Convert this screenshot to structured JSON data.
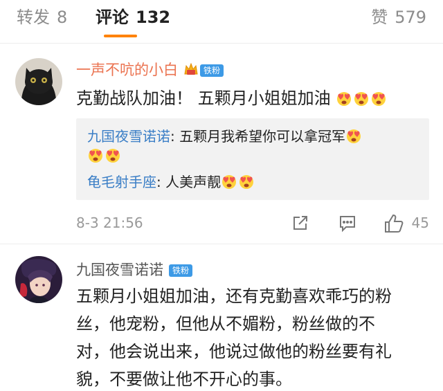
{
  "tabs": {
    "repost": {
      "label": "转发",
      "count": "8"
    },
    "comments": {
      "label": "评论",
      "count": "132"
    },
    "likes": {
      "label": "赞",
      "count": "579"
    }
  },
  "comments": [
    {
      "username": "一声不吭的小白",
      "fan_badge": "铁粉",
      "text": "克勤战队加油！ 五颗月小姐姐加油",
      "emojis": [
        "love-heart-emoji",
        "love-heart-emoji",
        "love-heart-emoji"
      ],
      "replies": [
        {
          "name": "九国夜雪诺诺",
          "text": "五颗月我希望你可以拿冠军"
        },
        {
          "name": "龟毛射手座",
          "text": "人美声靓"
        }
      ],
      "timestamp": "8-3 21:56",
      "like_count": "45"
    },
    {
      "username": "九国夜雪诺诺",
      "fan_badge": "铁粉",
      "lines": [
        "五颗月小姐姐加油，还有克勤喜欢乖巧的粉",
        "丝，他宠粉，但他从不媚粉，粉丝做的不",
        "对，他会说出来，他说过做他的粉丝要有礼",
        "貌，不要做让他不开心的事。"
      ]
    }
  ],
  "colors": {
    "accent": "#ff8200",
    "username_orange": "#eb7350",
    "reply_name_blue": "#3a7ec6",
    "badge_blue": "#3d9ae6",
    "reply_bg": "#f2f2f2"
  }
}
